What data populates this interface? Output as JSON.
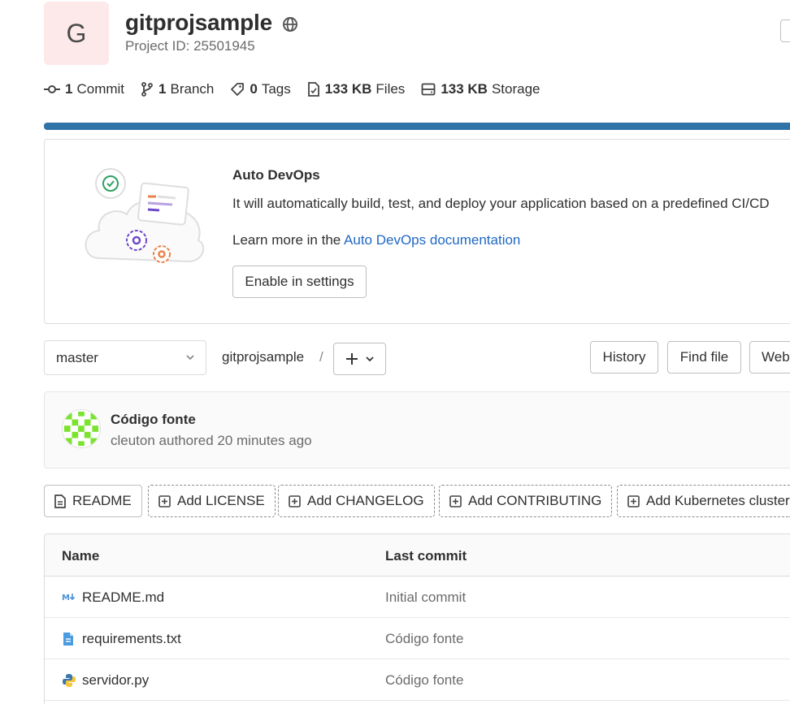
{
  "project": {
    "avatar_letter": "G",
    "name": "gitprojsample",
    "id_label": "Project ID: 25501945",
    "visibility_icon": "globe-icon"
  },
  "stats": {
    "commits": {
      "count": "1",
      "label": "Commit"
    },
    "branches": {
      "count": "1",
      "label": "Branch"
    },
    "tags": {
      "count": "0",
      "label": "Tags"
    },
    "files": {
      "count": "133 KB",
      "label": "Files"
    },
    "storage": {
      "count": "133 KB",
      "label": "Storage"
    }
  },
  "storage_bar": {
    "fill_fraction": 1.0,
    "color": "#3073a8"
  },
  "auto_devops": {
    "title": "Auto DevOps",
    "description": "It will automatically build, test, and deploy your application based on a predefined CI/CD",
    "learn_prefix": "Learn more in the ",
    "learn_link": "Auto DevOps documentation",
    "enable_button": "Enable in settings"
  },
  "toolbar": {
    "branch": "master",
    "breadcrumb": "gitprojsample",
    "separator": "/",
    "history_button": "History",
    "find_file_button": "Find file",
    "web_ide_button": "Web"
  },
  "last_commit": {
    "title": "Código fonte",
    "meta": "cleuton authored 20 minutes ago"
  },
  "doc_buttons": {
    "readme": "README",
    "license": "Add LICENSE",
    "changelog": "Add CHANGELOG",
    "contributing": "Add CONTRIBUTING",
    "kubernetes": "Add Kubernetes cluster"
  },
  "file_table": {
    "headers": {
      "name": "Name",
      "last_commit": "Last commit"
    },
    "rows": [
      {
        "name": "README.md",
        "commit": "Initial commit",
        "icon": "markdown-icon"
      },
      {
        "name": "requirements.txt",
        "commit": "Código fonte",
        "icon": "text-file-icon"
      },
      {
        "name": "servidor.py",
        "commit": "Código fonte",
        "icon": "python-icon"
      }
    ]
  },
  "colors": {
    "link": "#1f68c4",
    "accent_bar": "#3073a8",
    "avatar_bg": "#fde9ea"
  }
}
